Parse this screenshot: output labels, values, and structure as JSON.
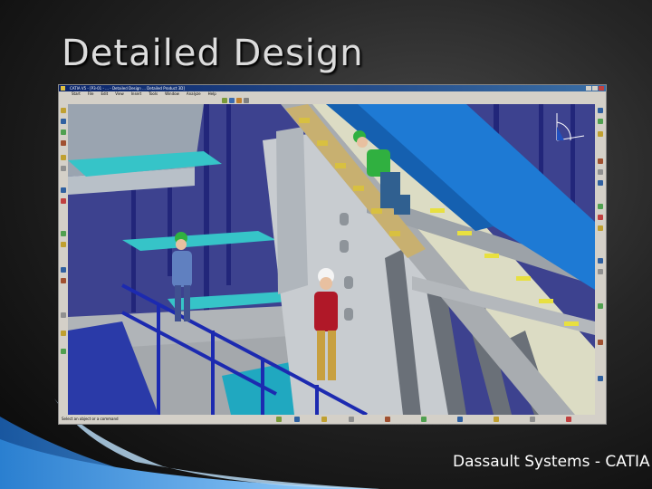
{
  "slide": {
    "title": "Detailed Design",
    "caption": "Dassault Systems - CATIA"
  },
  "app": {
    "window_title": "CATIA V5 - [P3-01 - ... - Detailed Design ... Detailed Product 3D]",
    "menu": [
      "Start",
      "File",
      "Edit",
      "View",
      "Insert",
      "Tools",
      "Window",
      "Analyze",
      "Help"
    ],
    "status_text": "Select an object or a command",
    "icons": {
      "left_toolbar": "catia-toolbar-icons",
      "right_toolbar": "catia-toolbar-icons",
      "compass": "compass-icon"
    }
  },
  "colors": {
    "title_text": "#dcdcdc",
    "caption_text": "#ffffff",
    "swoosh": "#3a8fd0",
    "viewport_bg": "#3b3f8f"
  }
}
